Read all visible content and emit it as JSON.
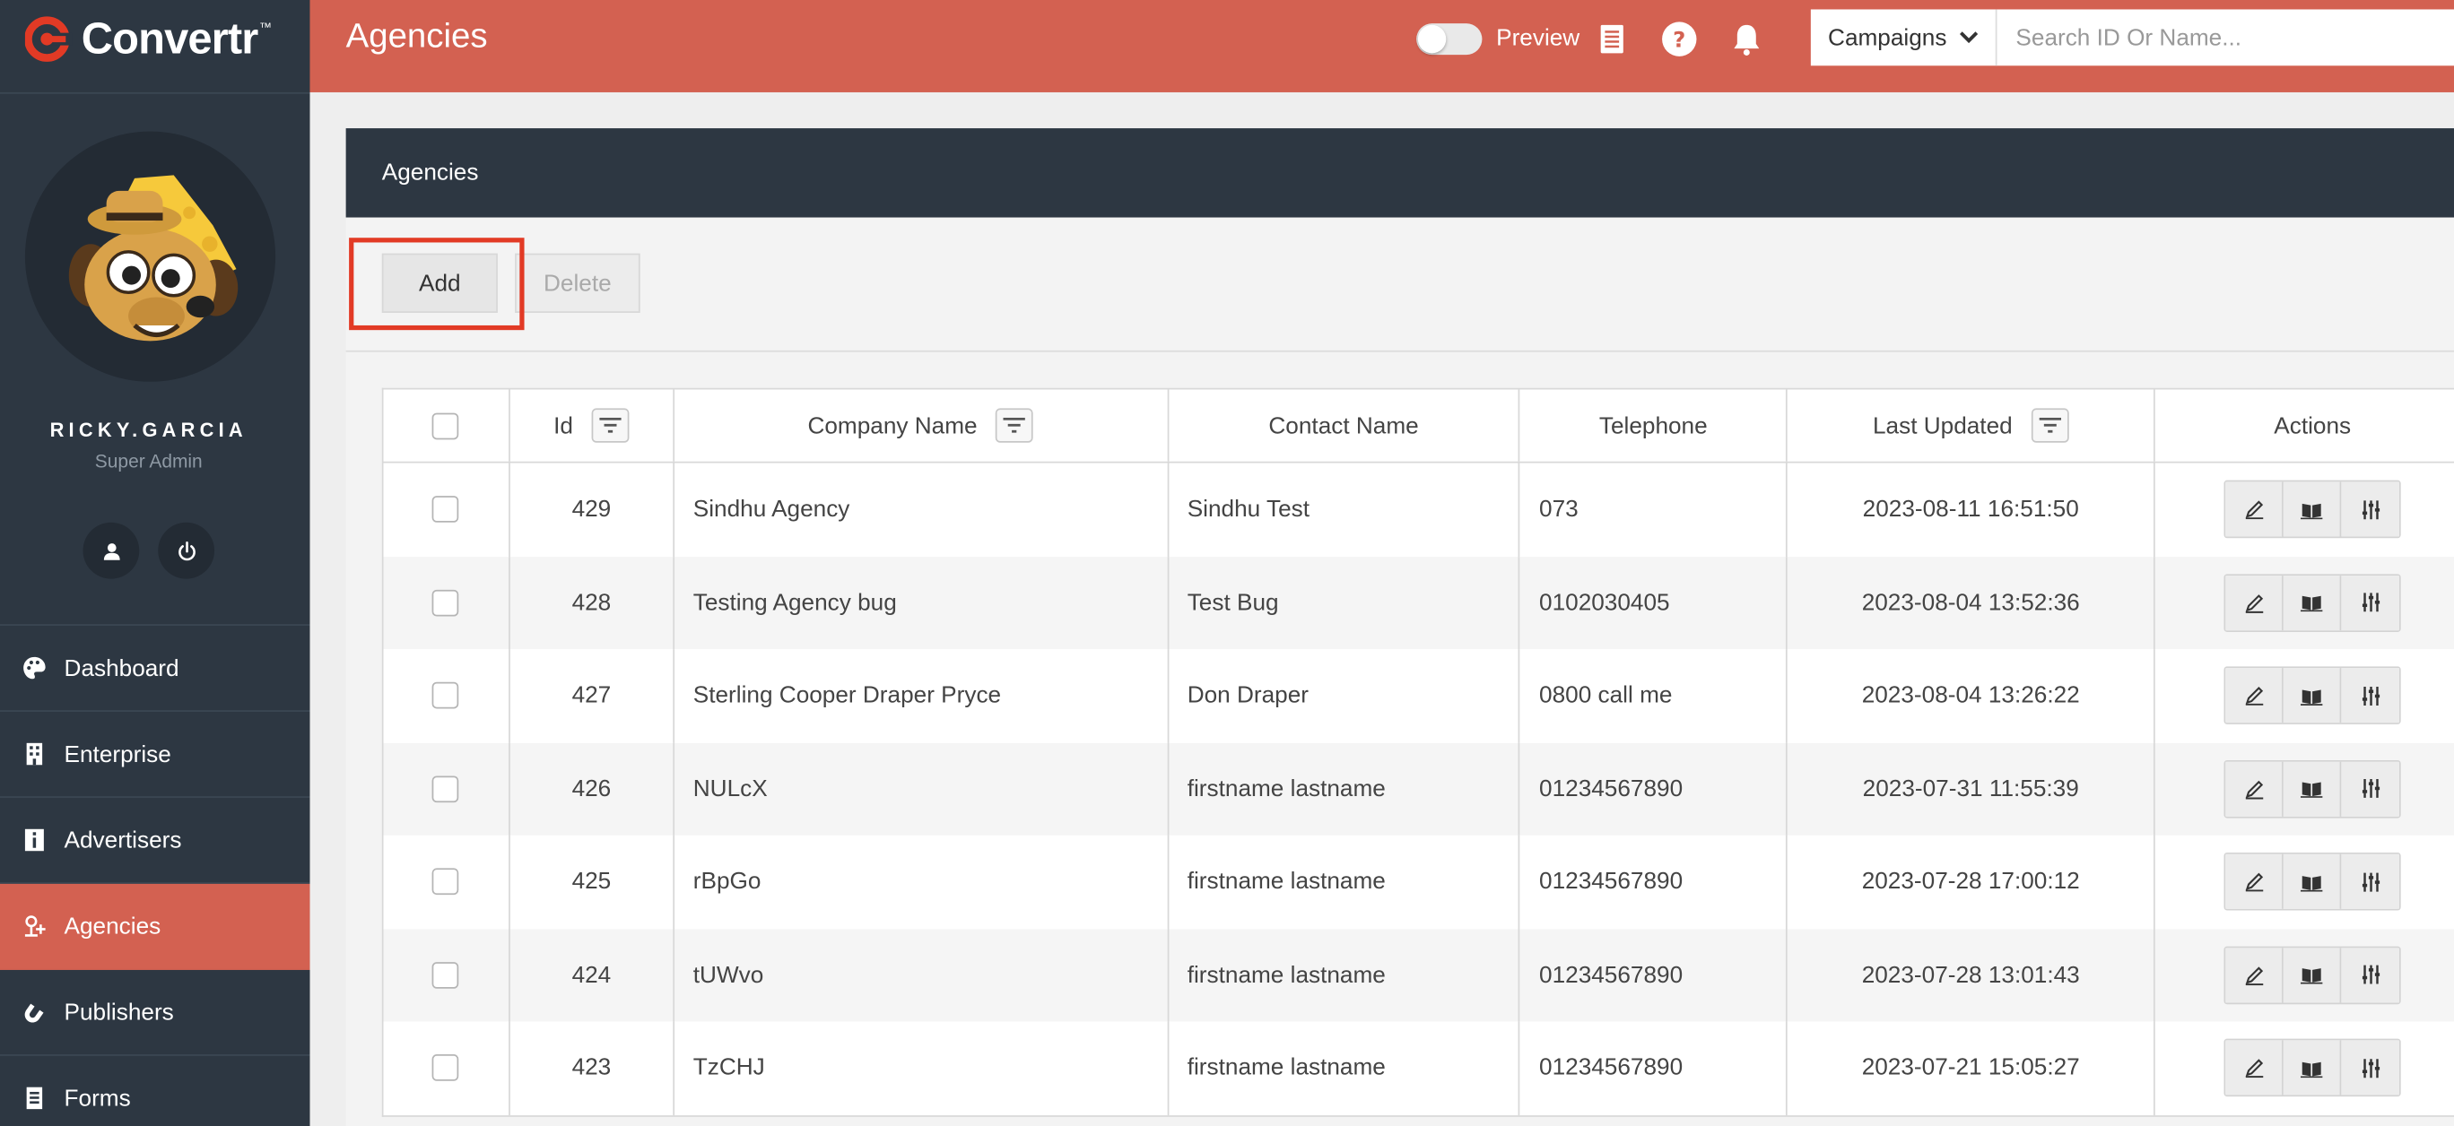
{
  "brand": {
    "name": "Convertr",
    "trademark": "™",
    "accent": "#d36151",
    "dark": "#2d3742",
    "logo_red": "#e23a25"
  },
  "user": {
    "name": "RICKY.GARCIA",
    "role": "Super Admin"
  },
  "sidebar": {
    "items": [
      {
        "label": "Dashboard",
        "icon": "palette-icon"
      },
      {
        "label": "Enterprise",
        "icon": "building-icon"
      },
      {
        "label": "Advertisers",
        "icon": "info-icon"
      },
      {
        "label": "Agencies",
        "icon": "agency-icon",
        "active": true
      },
      {
        "label": "Publishers",
        "icon": "magnet-icon"
      },
      {
        "label": "Forms",
        "icon": "form-icon"
      }
    ]
  },
  "header": {
    "title": "Agencies",
    "preview_label": "Preview",
    "campaigns_label": "Campaigns",
    "search_placeholder": "Search ID Or Name..."
  },
  "panel": {
    "title": "Agencies",
    "add_label": "Add",
    "delete_label": "Delete"
  },
  "table": {
    "columns": {
      "id": "Id",
      "company": "Company Name",
      "contact": "Contact Name",
      "telephone": "Telephone",
      "updated": "Last Updated",
      "actions": "Actions"
    },
    "rows": [
      {
        "id": "429",
        "company": "Sindhu Agency",
        "contact": "Sindhu Test",
        "telephone": "073",
        "updated": "2023-08-11 16:51:50"
      },
      {
        "id": "428",
        "company": "Testing Agency bug",
        "contact": "Test Bug",
        "telephone": "0102030405",
        "updated": "2023-08-04 13:52:36"
      },
      {
        "id": "427",
        "company": "Sterling Cooper Draper Pryce",
        "contact": "Don Draper",
        "telephone": "0800 call me",
        "updated": "2023-08-04 13:26:22"
      },
      {
        "id": "426",
        "company": "NULcX",
        "contact": "firstname lastname",
        "telephone": "01234567890",
        "updated": "2023-07-31 11:55:39"
      },
      {
        "id": "425",
        "company": "rBpGo",
        "contact": "firstname lastname",
        "telephone": "01234567890",
        "updated": "2023-07-28 17:00:12"
      },
      {
        "id": "424",
        "company": "tUWvo",
        "contact": "firstname lastname",
        "telephone": "01234567890",
        "updated": "2023-07-28 13:01:43"
      },
      {
        "id": "423",
        "company": "TzCHJ",
        "contact": "firstname lastname",
        "telephone": "01234567890",
        "updated": "2023-07-21 15:05:27"
      }
    ]
  }
}
